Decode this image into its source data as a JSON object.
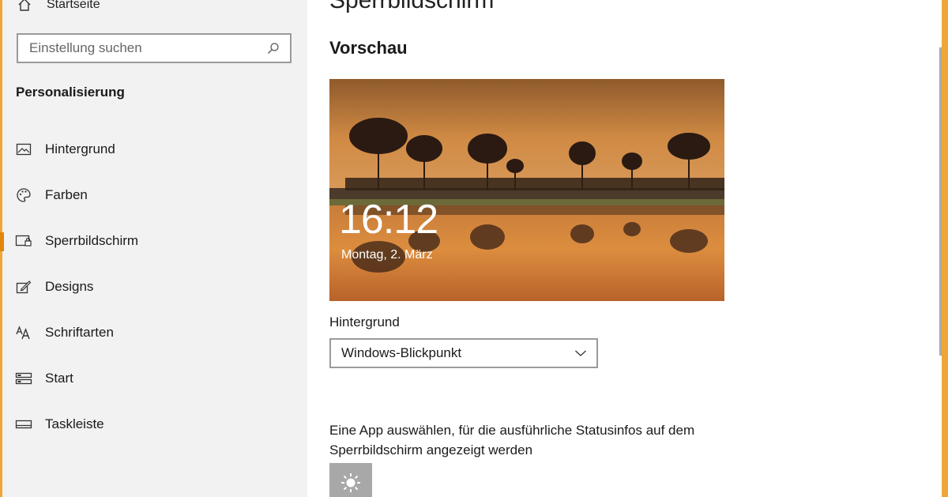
{
  "sidebar": {
    "home_label": "Startseite",
    "search_placeholder": "Einstellung suchen",
    "section_title": "Personalisierung",
    "items": [
      {
        "label": "Hintergrund",
        "icon": "picture-icon"
      },
      {
        "label": "Farben",
        "icon": "palette-icon"
      },
      {
        "label": "Sperrbildschirm",
        "icon": "lock-screen-icon",
        "active": true
      },
      {
        "label": "Designs",
        "icon": "brush-icon"
      },
      {
        "label": "Schriftarten",
        "icon": "font-icon"
      },
      {
        "label": "Start",
        "icon": "start-icon"
      },
      {
        "label": "Taskleiste",
        "icon": "taskbar-icon"
      }
    ]
  },
  "main": {
    "page_title": "Sperrbildschirm",
    "preview_title": "Vorschau",
    "preview": {
      "time": "16:12",
      "date": "Montag, 2. März"
    },
    "background_label": "Hintergrund",
    "background_select_value": "Windows-Blickpunkt",
    "app_description": "Eine App auswählen, für die ausführliche Statusinfos auf dem Sperrbildschirm angezeigt werden",
    "app_tile_icon": "weather-sun-icon"
  },
  "colors": {
    "accent": "#e2860b",
    "window_border": "#f0a637",
    "sidebar_bg": "#f2f2f2"
  }
}
